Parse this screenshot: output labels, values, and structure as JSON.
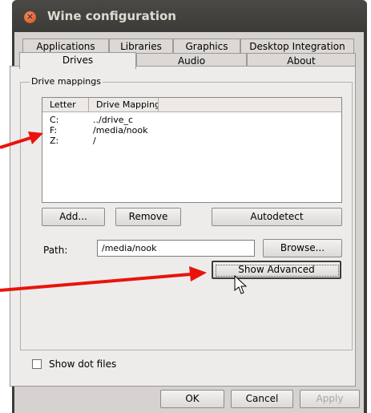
{
  "window": {
    "title": "Wine configuration",
    "close_glyph": "×"
  },
  "tabs_row1": [
    "Applications",
    "Libraries",
    "Graphics",
    "Desktop Integration"
  ],
  "tabs_row2": [
    "Drives",
    "Audio",
    "About"
  ],
  "active_tab": "Drives",
  "group_label": "Drive mappings",
  "list": {
    "columns": [
      "Letter",
      "Drive Mapping"
    ],
    "rows": [
      {
        "letter": "C:",
        "mapping": "../drive_c"
      },
      {
        "letter": "F:",
        "mapping": "/media/nook"
      },
      {
        "letter": "Z:",
        "mapping": "/"
      }
    ]
  },
  "buttons": {
    "add": "Add...",
    "remove": "Remove",
    "autodetect": "Autodetect",
    "browse": "Browse...",
    "show_advanced": "Show Advanced"
  },
  "path": {
    "label": "Path:",
    "value": "/media/nook"
  },
  "show_dot_files": {
    "label": "Show dot files",
    "checked": false
  },
  "footer": {
    "ok": "OK",
    "cancel": "Cancel",
    "apply": "Apply"
  },
  "annotation_color": "#e8140c"
}
